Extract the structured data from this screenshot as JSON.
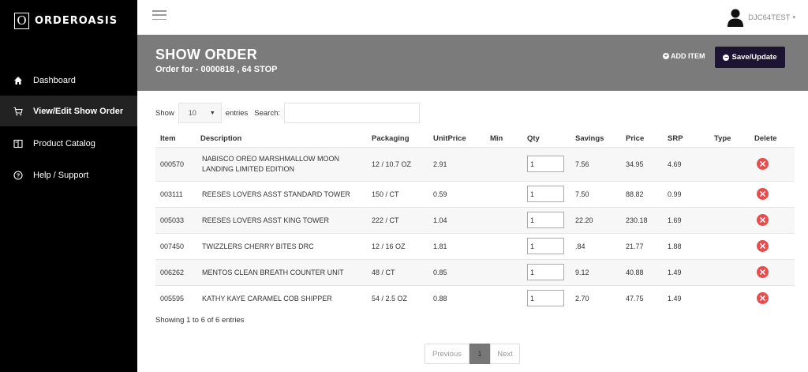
{
  "app": {
    "logo_letter": "O",
    "name": "ORDEROASIS"
  },
  "sidebar": {
    "items": [
      {
        "label": "Dashboard",
        "icon": "home-icon"
      },
      {
        "label": "View/Edit Show Order",
        "icon": "cart-icon",
        "active": true
      },
      {
        "label": "Product Catalog",
        "icon": "book-icon"
      },
      {
        "label": "Help / Support",
        "icon": "question-circle-icon"
      }
    ]
  },
  "user": {
    "name": "DJC64TEST",
    "caret": "▾"
  },
  "header": {
    "title": "SHOW ORDER",
    "subtitle": "Order for - 0000818 , 64 STOP",
    "add_item": "ADD ITEM",
    "save": "Save/Update"
  },
  "controls": {
    "show": "Show",
    "length_value": "10",
    "entries": "entries",
    "search": "Search:"
  },
  "table": {
    "headers": [
      "Item",
      "Description",
      "Packaging",
      "UnitPrice",
      "Min",
      "Qty",
      "Savings",
      "Price",
      "SRP",
      "Type",
      "Delete"
    ],
    "rows": [
      {
        "item": "000570",
        "desc_1": "NABISCO OREO MARSHMALLOW MOON",
        "desc_2": "LANDING LIMITED EDITION",
        "packaging": "12 / 10.7 OZ",
        "unit_price": "2.91",
        "min": "",
        "qty": "1",
        "savings": "7.56",
        "price": "34.95",
        "srp": "4.69",
        "type": ""
      },
      {
        "item": "003111",
        "desc_1": "REESES LOVERS ASST STANDARD TOWER",
        "desc_2": "",
        "packaging": "150 / CT",
        "unit_price": "0.59",
        "min": "",
        "qty": "1",
        "savings": "7.50",
        "price": "88.82",
        "srp": "0.99",
        "type": ""
      },
      {
        "item": "005033",
        "desc_1": "REESES LOVERS ASST KING TOWER",
        "desc_2": "",
        "packaging": "222 / CT",
        "unit_price": "1.04",
        "min": "",
        "qty": "1",
        "savings": "22.20",
        "price": "230.18",
        "srp": "1.69",
        "type": ""
      },
      {
        "item": "007450",
        "desc_1": "TWIZZLERS CHERRY BITES DRC",
        "desc_2": "",
        "packaging": "12 / 16 OZ",
        "unit_price": "1.81",
        "min": "",
        "qty": "1",
        "savings": ".84",
        "price": "21.77",
        "srp": "1.88",
        "type": ""
      },
      {
        "item": "006262",
        "desc_1": "MENTOS CLEAN BREATH COUNTER UNIT",
        "desc_2": "",
        "packaging": "48 / CT",
        "unit_price": "0.85",
        "min": "",
        "qty": "1",
        "savings": "9.12",
        "price": "40.88",
        "srp": "1.49",
        "type": ""
      },
      {
        "item": "005595",
        "desc_1": "KATHY KAYE CARAMEL COB SHIPPER",
        "desc_2": "",
        "packaging": "54 / 2.5 OZ",
        "unit_price": "0.88",
        "min": "",
        "qty": "1",
        "savings": "2.70",
        "price": "47.75",
        "srp": "1.49",
        "type": ""
      }
    ]
  },
  "info": "Showing 1 to 6 of 6 entries",
  "pager": {
    "prev": "Previous",
    "current": "1",
    "next": "Next"
  },
  "colors": {
    "sidebar": "#000000",
    "banner": "#7b7b7b",
    "save_button": "#1d1433",
    "delete": "#e84c4c"
  }
}
